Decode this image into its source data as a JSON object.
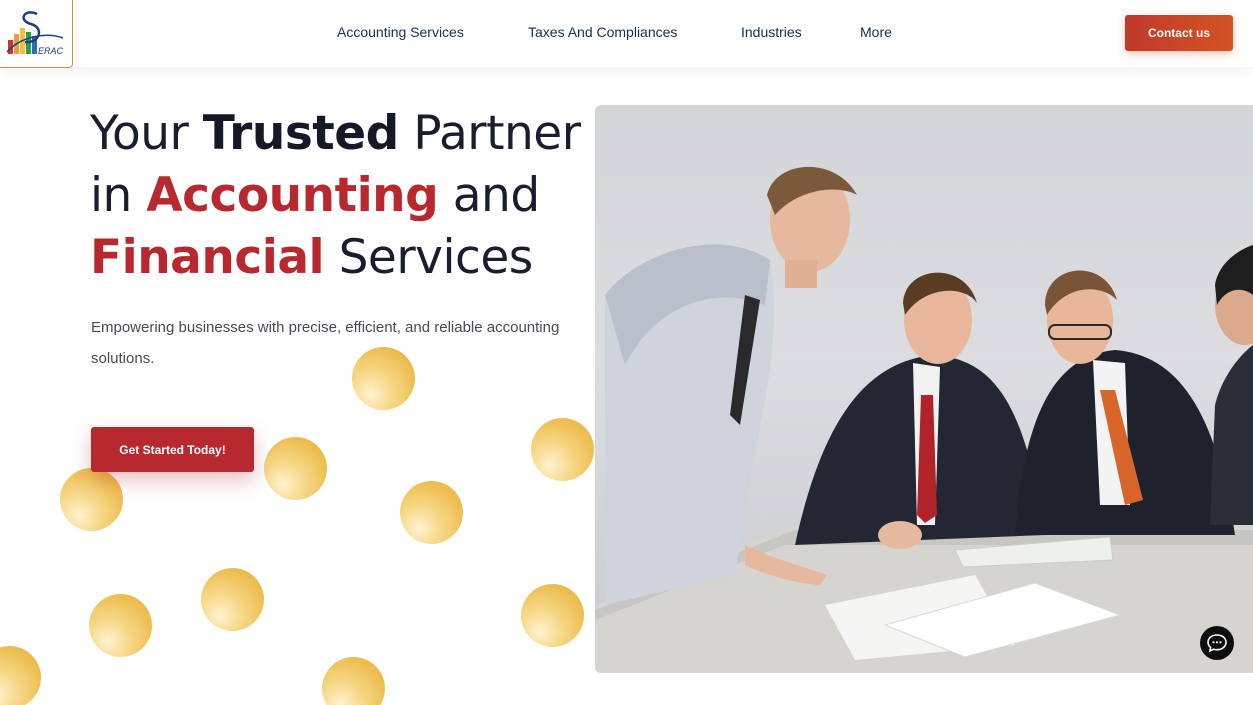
{
  "header": {
    "logo_text": "ERAC",
    "nav": [
      {
        "label": "Accounting Services"
      },
      {
        "label": "Taxes And Compliances"
      },
      {
        "label": "Industries"
      },
      {
        "label": "More"
      }
    ],
    "contact_label": "Contact us"
  },
  "hero": {
    "headline": {
      "w1": "Your ",
      "w2": "Trusted",
      "w3": " Partner",
      "w4": "in ",
      "w5": "Accounting",
      "w6": " and",
      "w7": "Financial",
      "w8": " Services"
    },
    "subtext": "Empowering businesses with precise, efficient, and reliable accounting solutions.",
    "cta_label": "Get Started Today!"
  },
  "colors": {
    "brand_red": "#b8292f",
    "contact_orange": "#d35424",
    "nav_text": "#14305a",
    "coin_gold": "#eebf52"
  },
  "icons": {
    "chat": "chat-bubble-icon",
    "logo": "bar-chart-logo"
  }
}
